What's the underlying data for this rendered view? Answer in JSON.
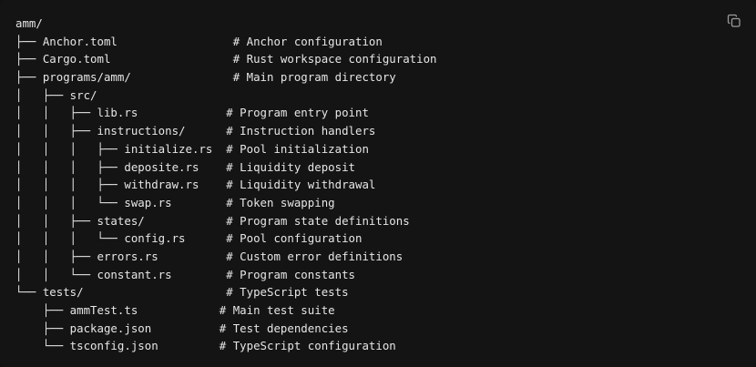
{
  "code_block": {
    "lines": [
      "amm/",
      "├── Anchor.toml                 # Anchor configuration",
      "├── Cargo.toml                  # Rust workspace configuration",
      "├── programs/amm/               # Main program directory",
      "│   ├── src/",
      "│   │   ├── lib.rs             # Program entry point",
      "│   │   ├── instructions/      # Instruction handlers",
      "│   │   │   ├── initialize.rs  # Pool initialization",
      "│   │   │   ├── deposite.rs    # Liquidity deposit",
      "│   │   │   ├── withdraw.rs    # Liquidity withdrawal",
      "│   │   │   └── swap.rs        # Token swapping",
      "│   │   ├── states/            # Program state definitions",
      "│   │   │   └── config.rs      # Pool configuration",
      "│   │   ├── errors.rs          # Custom error definitions",
      "│   │   └── constant.rs        # Program constants",
      "└── tests/                     # TypeScript tests",
      "    ├── ammTest.ts            # Main test suite",
      "    ├── package.json          # Test dependencies",
      "    └── tsconfig.json         # TypeScript configuration"
    ],
    "copy_icon": "copy-icon"
  },
  "colors": {
    "background": "#141414",
    "text": "#e6e6e6",
    "icon": "#9a9a9a"
  }
}
